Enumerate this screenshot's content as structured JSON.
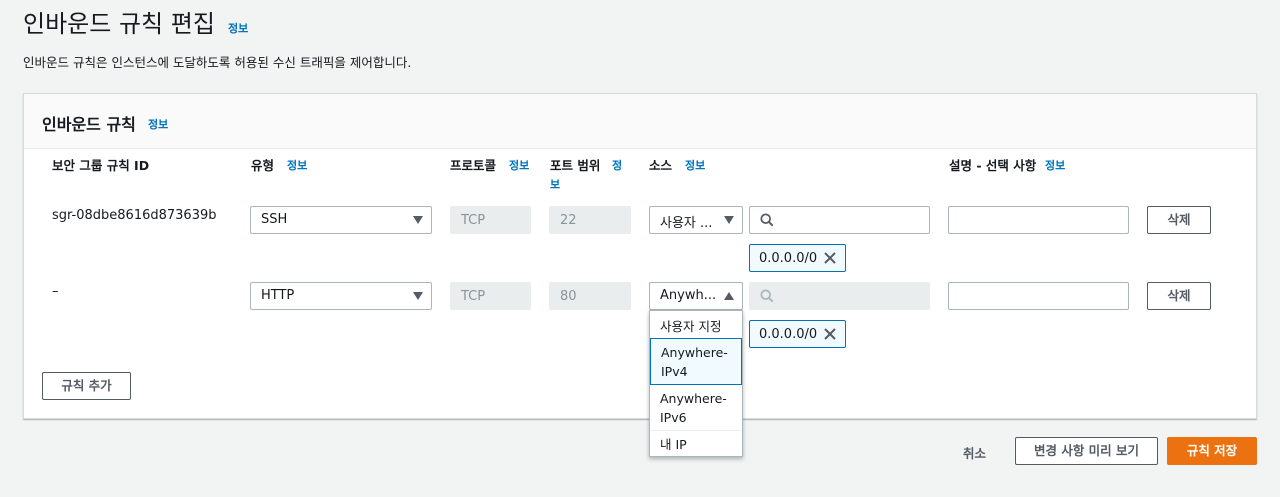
{
  "page": {
    "title": "인바운드 규칙 편집",
    "info": "정보",
    "description": "인바운드 규칙은 인스턴스에 도달하도록 허용된 수신 트래픽을 제어합니다."
  },
  "panel": {
    "title": "인바운드 규칙",
    "info": "정보",
    "columns": {
      "rule_id": "보안 그룹 규칙 ID",
      "type": "유형",
      "type_info": "정보",
      "protocol": "프로토콜",
      "protocol_info": "정보",
      "port_range": "포트 범위",
      "port_info_1": "정",
      "port_info_2": "보",
      "source": "소스",
      "source_info": "정보",
      "description": "설명 - 선택 사항",
      "description_info": "정보"
    },
    "rules": [
      {
        "rule_id": "sgr-08dbe8616d873639b",
        "type": "SSH",
        "protocol": "TCP",
        "port": "22",
        "source": "사용자 ...",
        "search_value": "",
        "cidr_token": "0.0.0.0/0",
        "description": "",
        "delete_label": "삭제"
      },
      {
        "rule_id": "–",
        "type": "HTTP",
        "protocol": "TCP",
        "port": "80",
        "source": "Anywh...",
        "search_value": "",
        "cidr_token": "0.0.0.0/0",
        "description": "",
        "delete_label": "삭제"
      }
    ],
    "add_rule_label": "규칙 추가"
  },
  "source_dropdown": {
    "options": [
      {
        "line1": "사용자 지정",
        "line2": ""
      },
      {
        "line1": "Anywhere-",
        "line2": "IPv4",
        "selected": true
      },
      {
        "line1": "Anywhere-",
        "line2": "IPv6"
      },
      {
        "line1": "내 IP",
        "line2": ""
      }
    ]
  },
  "footer": {
    "cancel_label": "취소",
    "preview_label": "변경 사항 미리 보기",
    "save_label": "규칙 저장"
  },
  "colors": {
    "link": "#0073bb",
    "primary": "#ec7211",
    "background": "#f2f3f3"
  }
}
